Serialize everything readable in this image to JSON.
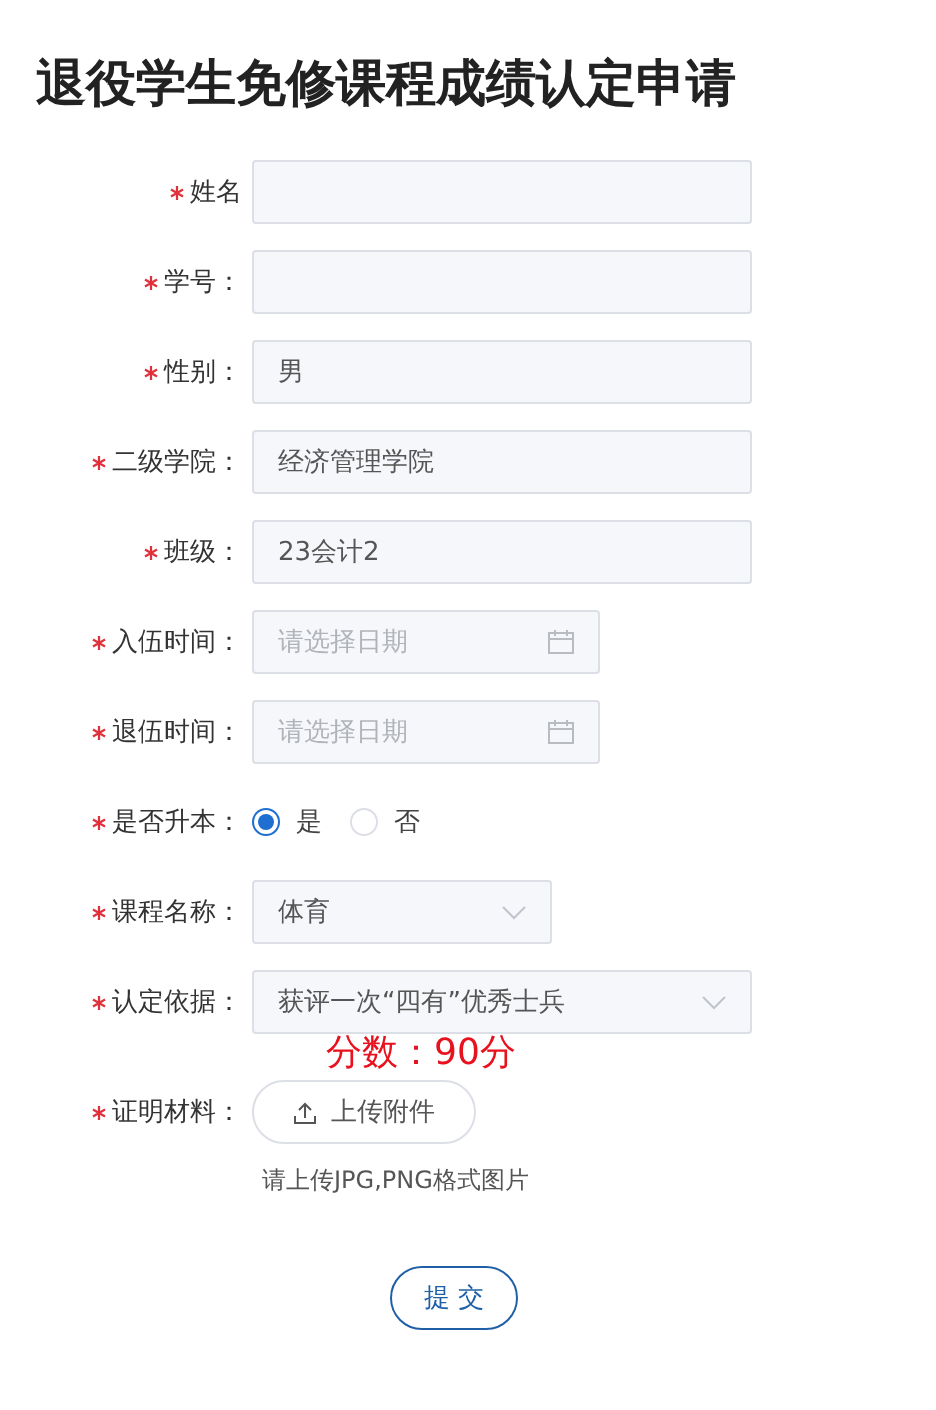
{
  "title": "退役学生免修课程成绩认定申请",
  "fields": [
    {
      "kind": "text",
      "label": "姓名",
      "required": true
    },
    {
      "kind": "text",
      "label": "学号：",
      "required": true
    },
    {
      "kind": "text",
      "label": "性别：",
      "required": true,
      "value": "男"
    },
    {
      "kind": "text",
      "label": "二级学院：",
      "required": true,
      "value": "经济管理学院"
    },
    {
      "kind": "text",
      "label": "班级：",
      "required": true,
      "value": "23会计2"
    },
    {
      "kind": "date",
      "label": "入伍时间：",
      "required": true,
      "placeholder": "请选择日期"
    },
    {
      "kind": "date",
      "label": "退伍时间：",
      "required": true,
      "placeholder": "请选择日期"
    },
    {
      "kind": "radio",
      "label": "是否升本：",
      "required": true,
      "options": [
        {
          "label": "是",
          "selected": true
        },
        {
          "label": "否",
          "selected": false
        }
      ]
    },
    {
      "kind": "select",
      "label": "课程名称：",
      "required": true,
      "value": "体育"
    },
    {
      "kind": "select",
      "label": "认定依据：",
      "required": true,
      "value": "获评一次“四有”优秀士兵"
    }
  ],
  "score": "分数：90分",
  "upload": {
    "label": "证明材料：",
    "required": true,
    "button": "上传附件",
    "hint": "请上传JPG,PNG格式图片"
  },
  "submit": "提 交"
}
